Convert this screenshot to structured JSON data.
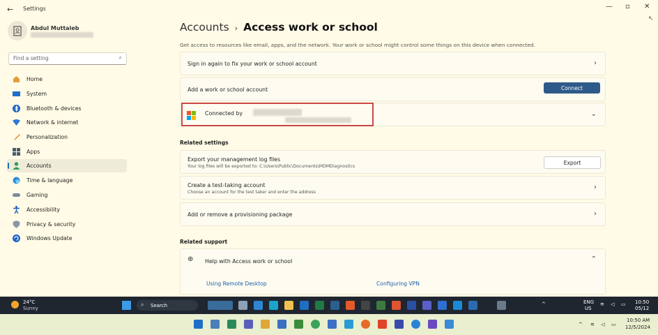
{
  "window": {
    "title": "Settings"
  },
  "profile": {
    "name": "Abdul Muttaleb"
  },
  "search": {
    "placeholder": "Find a setting"
  },
  "sidebar": {
    "items": [
      {
        "label": "Home"
      },
      {
        "label": "System"
      },
      {
        "label": "Bluetooth & devices"
      },
      {
        "label": "Network & internet"
      },
      {
        "label": "Personalization"
      },
      {
        "label": "Apps"
      },
      {
        "label": "Accounts"
      },
      {
        "label": "Time & language"
      },
      {
        "label": "Gaming"
      },
      {
        "label": "Accessibility"
      },
      {
        "label": "Privacy & security"
      },
      {
        "label": "Windows Update"
      }
    ]
  },
  "main": {
    "breadcrumb_parent": "Accounts",
    "breadcrumb_sep": "›",
    "breadcrumb_current": "Access work or school",
    "description": "Get access to resources like email, apps, and the network. Your work or school might control some things on this device when connected.",
    "signin_card": "Sign in again to fix your work or school account",
    "add_card": "Add a work or school account",
    "connect_button": "Connect",
    "connected_card": "Connected by",
    "related_settings": "Related settings",
    "export_title": "Export your management log files",
    "export_sub": "Your log files will be exported to: C:\\Users\\Public\\Documents\\MDMDiagnostics",
    "export_button": "Export",
    "test_title": "Create a test-taking account",
    "test_sub": "Choose an account for the test taker and enter the address",
    "provision_title": "Add or remove a provisioning package",
    "related_support": "Related support",
    "help_title": "Help with Access work or school",
    "link1": "Using Remote Desktop",
    "link2": "Configuring VPN"
  },
  "taskbar": {
    "temp": "24°C",
    "weather": "Sunny",
    "search": "Search",
    "lang": "ENG",
    "region": "US",
    "time": "10:50",
    "date": "05/12"
  },
  "taskbar2": {
    "time": "10:50 AM",
    "date": "12/5/2024"
  }
}
